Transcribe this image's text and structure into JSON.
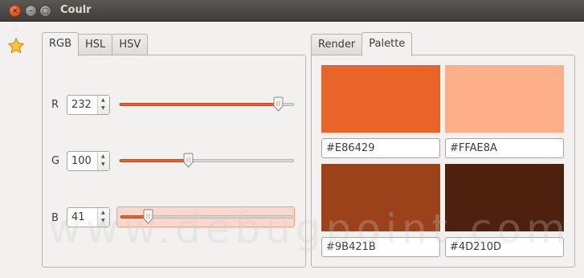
{
  "window": {
    "title": "Coulr"
  },
  "titlebar_buttons": {
    "close": "×",
    "minimize": "–",
    "maximize": "□"
  },
  "sidebar": {
    "grip": "∷",
    "icon": "star-icon"
  },
  "left_tabs": [
    "RGB",
    "HSL",
    "HSV"
  ],
  "rgb": {
    "rows": [
      {
        "label": "R",
        "value": "232",
        "fraction": 0.9098
      },
      {
        "label": "G",
        "value": "100",
        "fraction": 0.3922
      },
      {
        "label": "B",
        "value": "41",
        "fraction": 0.1608
      }
    ]
  },
  "right_tabs": [
    "Render",
    "Palette"
  ],
  "palette": {
    "swatches": [
      {
        "color": "#E86429",
        "hex": "#E86429"
      },
      {
        "color": "#FFAE8A",
        "hex": "#FFAE8A"
      },
      {
        "color": "#9B421B",
        "hex": "#9B421B"
      },
      {
        "color": "#4D210D",
        "hex": "#4D210D"
      }
    ]
  },
  "accent": "#E8602D",
  "watermark": "www.debugpoint.com"
}
